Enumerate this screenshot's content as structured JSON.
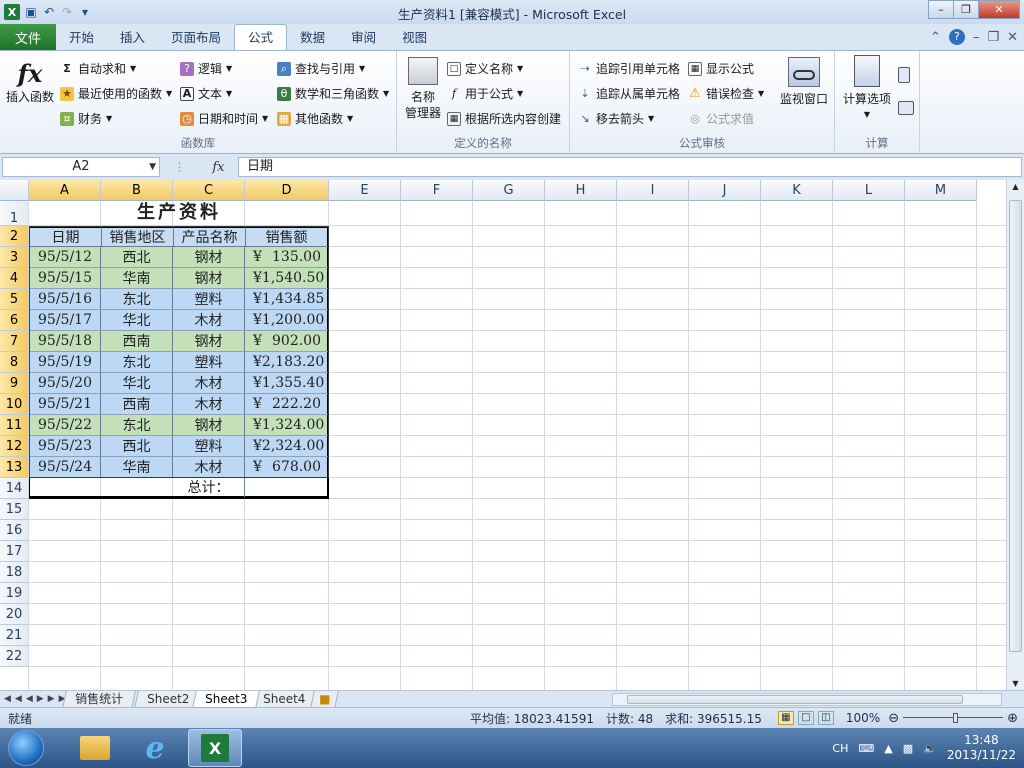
{
  "window": {
    "title": "生产资料1  [兼容模式] - Microsoft Excel"
  },
  "tabs": {
    "file": "文件",
    "items": [
      "开始",
      "插入",
      "页面布局",
      "公式",
      "数据",
      "审阅",
      "视图"
    ],
    "active_index": 3
  },
  "ribbon": {
    "library": {
      "insert_function": "插入函数",
      "autosum": "自动求和",
      "recent": "最近使用的函数",
      "finance": "财务",
      "logic": "逻辑",
      "text": "文本",
      "datetime": "日期和时间",
      "lookup": "查找与引用",
      "math": "数学和三角函数",
      "other": "其他函数",
      "label": "函数库"
    },
    "names": {
      "manager_line1": "名称",
      "manager_line2": "管理器",
      "define": "定义名称",
      "use_in_formula": "用于公式",
      "create_from_selection": "根据所选内容创建",
      "label": "定义的名称"
    },
    "audit": {
      "trace_precedents": "追踪引用单元格",
      "trace_dependents": "追踪从属单元格",
      "remove_arrows": "移去箭头",
      "show_formulas": "显示公式",
      "error_check": "错误检查",
      "evaluate": "公式求值",
      "watch": "监视窗口",
      "label": "公式审核"
    },
    "calc": {
      "options": "计算选项",
      "label": "计算"
    }
  },
  "formula_bar": {
    "name_box": "A2",
    "fx": "fx",
    "content": "日期"
  },
  "sheet": {
    "columns": [
      "A",
      "B",
      "C",
      "D",
      "E",
      "F",
      "G",
      "H",
      "I",
      "J",
      "K",
      "L",
      "M"
    ],
    "rows": [
      "1",
      "2",
      "3",
      "4",
      "5",
      "6",
      "7",
      "8",
      "9",
      "10",
      "11",
      "12",
      "13",
      "14",
      "15",
      "16",
      "17",
      "18",
      "19",
      "20",
      "21",
      "22"
    ],
    "title": "生产资料",
    "headers": [
      "日期",
      "销售地区",
      "产品名称",
      "销售额"
    ],
    "data": [
      {
        "date": "95/5/12",
        "region": "西北",
        "product": "钢材",
        "amount": "135.00"
      },
      {
        "date": "95/5/15",
        "region": "华南",
        "product": "钢材",
        "amount": "1,540.50"
      },
      {
        "date": "95/5/16",
        "region": "东北",
        "product": "塑料",
        "amount": "1,434.85"
      },
      {
        "date": "95/5/17",
        "region": "华北",
        "product": "木材",
        "amount": "1,200.00"
      },
      {
        "date": "95/5/18",
        "region": "西南",
        "product": "钢材",
        "amount": "902.00"
      },
      {
        "date": "95/5/19",
        "region": "东北",
        "product": "塑料",
        "amount": "2,183.20"
      },
      {
        "date": "95/5/20",
        "region": "华北",
        "product": "木材",
        "amount": "1,355.40"
      },
      {
        "date": "95/5/21",
        "region": "西南",
        "product": "木材",
        "amount": "222.20"
      },
      {
        "date": "95/5/22",
        "region": "东北",
        "product": "钢材",
        "amount": "1,324.00"
      },
      {
        "date": "95/5/23",
        "region": "西北",
        "product": "塑料",
        "amount": "2,324.00"
      },
      {
        "date": "95/5/24",
        "region": "华南",
        "product": "木材",
        "amount": "678.00"
      }
    ],
    "currency": "¥",
    "total_label": "总计：",
    "colors": {
      "green_row": "#c3e0b8",
      "blue_row": "#bcd8f4",
      "header_row": "#c6dcf2"
    }
  },
  "sheet_tabs": [
    "销售统计",
    "Sheet2",
    "Sheet3",
    "Sheet4"
  ],
  "active_sheet_index": 2,
  "status": {
    "ready": "就绪",
    "average": "平均值: 18023.41591",
    "count": "计数: 48",
    "sum": "求和: 396515.15",
    "zoom": "100%"
  },
  "taskbar": {
    "ime": "CH",
    "time": "13:48",
    "date": "2013/11/22"
  }
}
